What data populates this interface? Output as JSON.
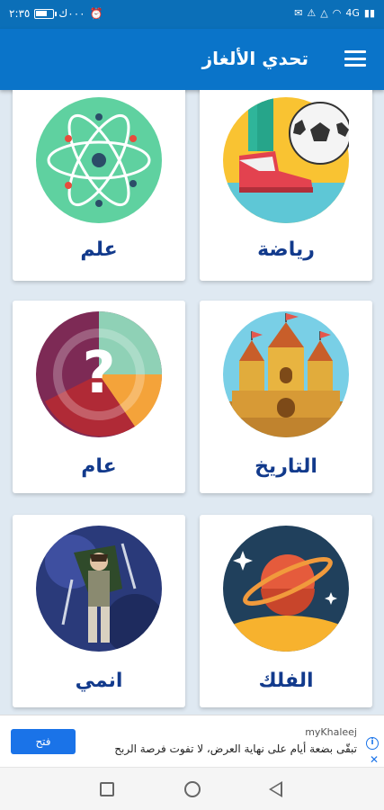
{
  "status_bar": {
    "time": "٢:٣٥",
    "speed": "٠٠٠ك",
    "signal_label": "4G"
  },
  "app_bar": {
    "title": "تحدي الألغاز",
    "menu_icon": "hamburger-menu-icon"
  },
  "categories": [
    {
      "label": "رياضة",
      "icon": "soccer-kick-icon"
    },
    {
      "label": "علم",
      "icon": "atom-icon"
    },
    {
      "label": "التاريخ",
      "icon": "castle-icon"
    },
    {
      "label": "عام",
      "icon": "question-mark-icon"
    },
    {
      "label": "الفلك",
      "icon": "planet-icon"
    },
    {
      "label": "انمي",
      "icon": "anime-character-icon"
    }
  ],
  "ad": {
    "brand": "myKhaleej",
    "text": "تبقّى بضعة أيام على نهاية العرض، لا تفوت فرصة الربح",
    "open_label": "فتح"
  },
  "nav": {
    "recent_icon": "recent-apps-icon",
    "home_icon": "home-icon",
    "back_icon": "back-icon"
  }
}
